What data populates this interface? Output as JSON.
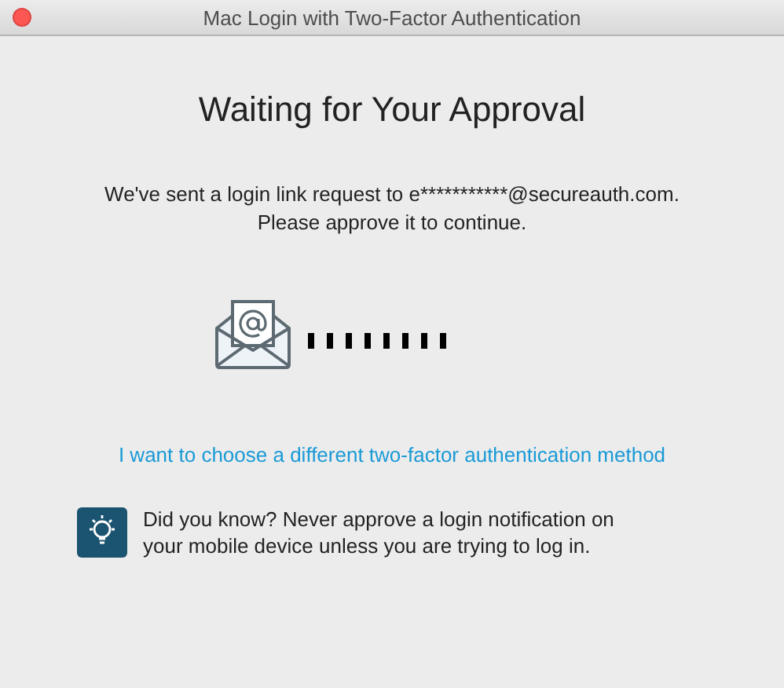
{
  "window": {
    "title": "Mac Login with Two-Factor Authentication"
  },
  "heading": "Waiting for Your Approval",
  "message": [
    "We've sent a login link request to e***********@secureauth.com.",
    "Please approve it to continue."
  ],
  "link": "I want to choose a different two-factor authentication method",
  "tip": "Did you know? Never approve a login notification on your mobile device unless you are trying to log in."
}
